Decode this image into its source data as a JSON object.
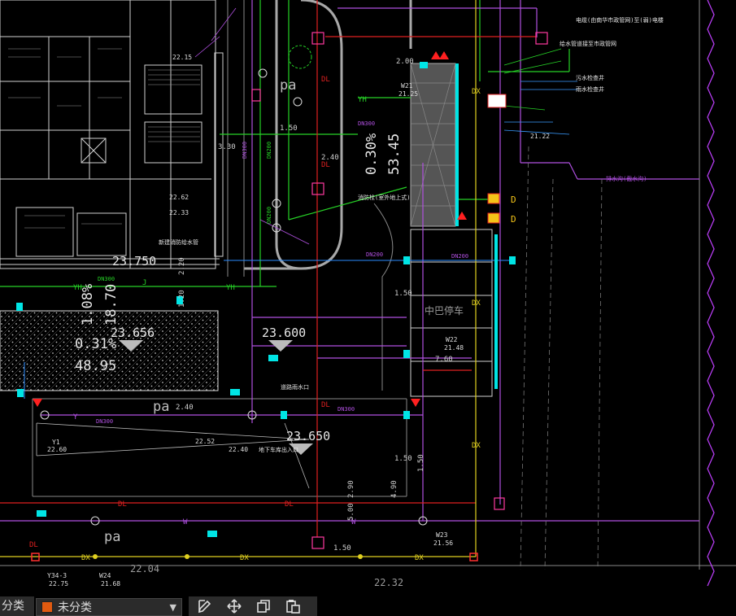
{
  "drawing": {
    "elevations": {
      "e1": "23.750",
      "e2": "23.656",
      "e3": "23.600",
      "e4": "23.650",
      "e5": "22.04",
      "e6": "22.32"
    },
    "slopes": {
      "s1": "0.30%",
      "s2": "53.45",
      "s3": "1.08%",
      "s4": "18.70",
      "s5": "0.31%",
      "s6": "48.95"
    },
    "labels": {
      "pa1": "pa",
      "pa2": "pa",
      "pa3": "pa",
      "parking": "中巴停车",
      "dl": "DL",
      "dx": "DX",
      "yh": "YH",
      "w": "W",
      "j": "J",
      "y": "Y",
      "d": "D"
    },
    "dims": {
      "d1": "2.00",
      "d2": "1.50",
      "d3": "2.40",
      "d4": "1.50",
      "d5": "1.50",
      "d6": "7.60",
      "d7": "2.40",
      "d8": "1.50",
      "d9": "2.90",
      "d10": "4.90",
      "d11": "5.00",
      "d12": "1.50",
      "d13": "3.30",
      "d14": "1.20",
      "d15": "2.20"
    },
    "pipe_tags": {
      "p1": "DN300",
      "p2": "DN200",
      "p3": "DN200",
      "p4": "DN300",
      "p5": "DN200",
      "p6": "DN300",
      "p7": "DN300",
      "p8": "DN200",
      "p9": "DN300"
    },
    "points": {
      "w21": "W21",
      "w21v": "21.25",
      "w22": "W22",
      "w22v": "21.48",
      "w23": "W23",
      "w23v": "21.56",
      "y1": "Y1",
      "y1v": "22.60",
      "y34": "Y34-3",
      "y34v": "22.75",
      "w24": "W24",
      "w24v": "21.68",
      "v1": "22.52",
      "v2": "22.40",
      "v3": "22.62",
      "v4": "22.33",
      "v5": "21.22",
      "v6": "22.15"
    },
    "notes": {
      "n1": "电缆(由南华市政管网)至(弱)电楼",
      "n2": "给水管道接至市政管网",
      "n3": "污水检查井",
      "n4": "雨水检查井",
      "n5": "新建消防给水管",
      "n6": "排水沟(截水沟)",
      "n7": "地下车库出入口",
      "n8": "消防栓(室外地上式)",
      "n9": "道路雨水口"
    }
  },
  "toolbar": {
    "layer_prefix": "分类",
    "layer_name": "未分类",
    "layer_color": "#e05a10",
    "icons": [
      "edit-icon",
      "move-icon",
      "copy-icon",
      "paste-icon"
    ]
  }
}
